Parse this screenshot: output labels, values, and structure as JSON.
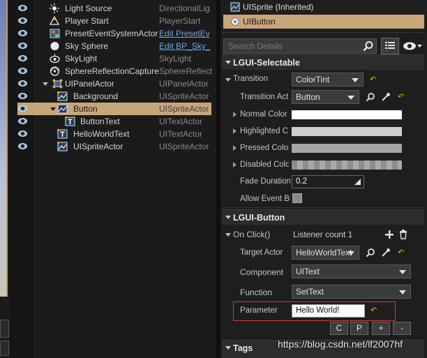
{
  "outliner": {
    "rows": [
      {
        "label": "Light Source",
        "type": "DirectionalLig",
        "icon": "sun-icon"
      },
      {
        "label": "Player Start",
        "type": "PlayerStart",
        "icon": "player-start-icon"
      },
      {
        "label": "PresetEventSystemActor",
        "type": "Edit PresetEv",
        "icon": "blueprint-icon"
      },
      {
        "label": "Sky Sphere",
        "type": "Edit BP_Sky_",
        "icon": "sphere-icon"
      },
      {
        "label": "SkyLight",
        "type": "SkyLight",
        "icon": "skylight-icon"
      },
      {
        "label": "SphereReflectionCapture",
        "type": "SphereReflect",
        "icon": "reflection-icon"
      },
      {
        "label": "UIPanelActor",
        "type": "UIPanelActor",
        "icon": "ui-panel-icon"
      },
      {
        "label": "Background",
        "type": "UISpriteActor",
        "icon": "sprite-icon"
      },
      {
        "label": "Button",
        "type": "UISpriteActor",
        "icon": "sprite-icon"
      },
      {
        "label": "ButtonText",
        "type": "UITextActor",
        "icon": "text-icon"
      },
      {
        "label": "HelloWorldText",
        "type": "UITextActor",
        "icon": "text-icon"
      },
      {
        "label": "UISpriteActor",
        "type": "UISpriteActor",
        "icon": "sprite-icon"
      }
    ]
  },
  "details": {
    "components": [
      {
        "label": "UISprite (Inherited)"
      },
      {
        "label": "UIButton"
      }
    ],
    "search_placeholder": "Search Details",
    "selectable": {
      "header": "LGUI-Selectable",
      "transition_label": "Transition",
      "transition_value": "ColorTint",
      "transition_actor_label": "Transition Act",
      "transition_actor_value": "Button",
      "normal_color_label": "Normal Color",
      "highlighted_color_label": "Highlighted C",
      "pressed_color_label": "Pressed Color",
      "disabled_color_label": "Disabled Colo",
      "fade_duration_label": "Fade Duration",
      "fade_duration_value": "0.2",
      "allow_event_label": "Allow Event Bub"
    },
    "button": {
      "header": "LGUI-Button",
      "onclick_label": "On Click()",
      "listener_count": "Listener count 1",
      "target_actor_label": "Target Actor",
      "target_actor_value": "HelloWorldText",
      "component_label": "Component",
      "component_value": "UIText",
      "function_label": "Function",
      "function_value": "SetText",
      "parameter_label": "Parameter",
      "parameter_value": "Hello World!",
      "buttons": [
        "C",
        "P",
        "+",
        "-"
      ]
    },
    "tags_header": "Tags"
  },
  "watermark": "https://blog.csdn.net/lf2007hf",
  "colors": {
    "selection": "#c8a67a",
    "highlight_box": "#d83a3a",
    "link": "#6aa9e8",
    "reset_arrow": "#e0b000"
  }
}
